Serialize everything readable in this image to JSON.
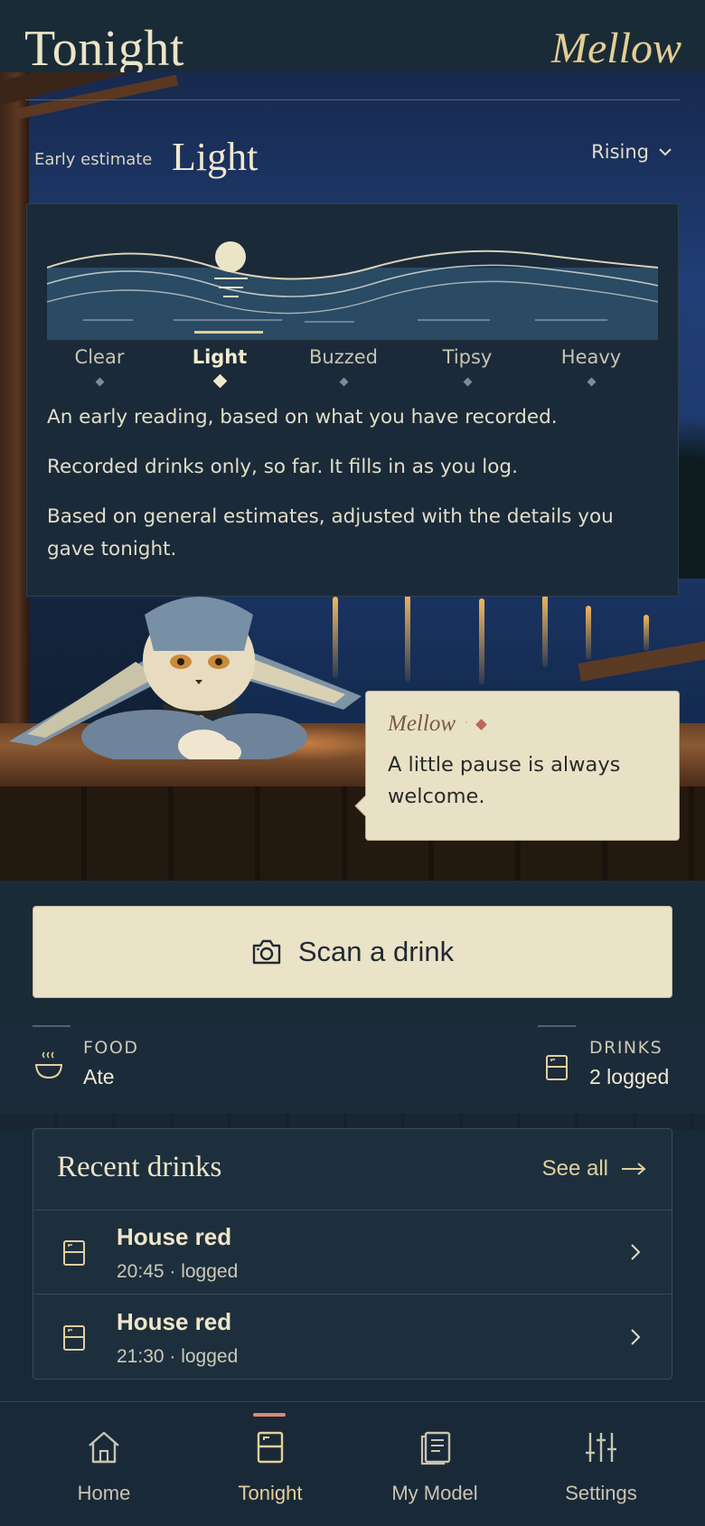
{
  "header": {
    "title": "Tonight",
    "brand": "Mellow"
  },
  "estimate": {
    "label": "Early estimate",
    "value": "Light",
    "trend": "Rising"
  },
  "gauge": {
    "levels": [
      "Clear",
      "Light",
      "Buzzed",
      "Tipsy",
      "Heavy"
    ],
    "active_level": "Light",
    "notes": [
      "An early reading, based on what you have recorded.",
      "Recorded drinks only, so far. It fills in as you log.",
      "Based on general estimates, adjusted with the details you gave tonight."
    ]
  },
  "bubble": {
    "name": "Mellow",
    "separator": "·",
    "text": "A little pause is always welcome."
  },
  "scan": {
    "label": "Scan a drink",
    "icon": "camera-icon"
  },
  "stats": {
    "food": {
      "label": "FOOD",
      "value": "Ate",
      "icon": "bowl-icon"
    },
    "drinks": {
      "label": "DRINKS",
      "value": "2 logged",
      "icon": "glass-icon"
    }
  },
  "recent": {
    "title": "Recent drinks",
    "see_all": "See all",
    "items": [
      {
        "name": "House red",
        "meta": "20:45 · logged"
      },
      {
        "name": "House red",
        "meta": "21:30 · logged"
      }
    ]
  },
  "nav": {
    "items": [
      {
        "label": "Home",
        "icon": "home-icon"
      },
      {
        "label": "Tonight",
        "icon": "glass-icon"
      },
      {
        "label": "My Model",
        "icon": "book-icon"
      },
      {
        "label": "Settings",
        "icon": "sliders-icon"
      }
    ],
    "active": "Tonight"
  },
  "colors": {
    "background": "#182a38",
    "cream": "#ebe3c7",
    "gold": "#e3cf94",
    "accent": "#d98a78"
  }
}
